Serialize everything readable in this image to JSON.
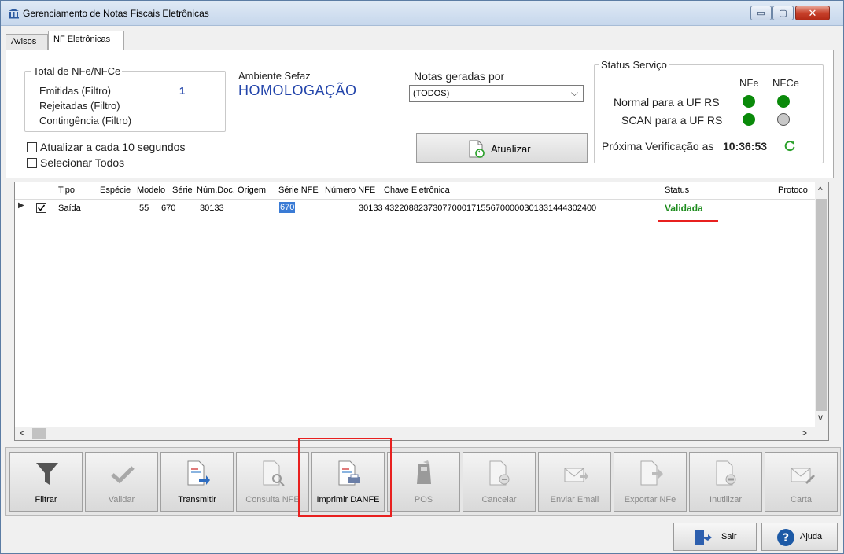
{
  "window": {
    "title": "Gerenciamento de Notas Fiscais Eletrônicas",
    "controls": {
      "minimize": "▭",
      "maximize": "▢",
      "close": "✕"
    }
  },
  "tabs": [
    {
      "label": "Avisos",
      "active": false
    },
    {
      "label": "NF Eletrônicas",
      "active": true
    }
  ],
  "totals": {
    "title": "Total de NFe/NFCe",
    "rows": [
      {
        "label": "Emitidas (Filtro)",
        "value": "1"
      },
      {
        "label": "Rejeitadas (Filtro)",
        "value": ""
      },
      {
        "label": "Contingência (Filtro)",
        "value": ""
      }
    ]
  },
  "ambiente": {
    "label": "Ambiente Sefaz",
    "value": "HOMOLOGAÇÃO"
  },
  "notas": {
    "label": "Notas geradas por",
    "selected": "(TODOS)"
  },
  "options": {
    "auto_refresh": {
      "label": "Atualizar a cada 10 segundos",
      "checked": false
    },
    "select_all": {
      "label": "Selecionar Todos",
      "checked": false
    }
  },
  "refresh_button": {
    "label": "Atualizar"
  },
  "status_servico": {
    "title": "Status Serviço",
    "col_nfe": "NFe",
    "col_nfce": "NFCe",
    "rows": [
      {
        "label": "Normal para a UF RS",
        "nfe": "green",
        "nfce": "green"
      },
      {
        "label": "SCAN para a UF RS",
        "nfe": "green",
        "nfce": "gray"
      }
    ],
    "next_check_label": "Próxima Verificação as",
    "next_check_time": "10:36:53"
  },
  "colors": {
    "ok": "#0a8a0a",
    "off": "#c8c8c8",
    "status_validada": "#1e8c1e",
    "ambiente": "#2244aa",
    "highlight": "#e8201f"
  },
  "grid": {
    "columns": [
      "Tipo",
      "Espécie",
      "Modelo",
      "Série",
      "Núm.Doc. Origem",
      "Série NFE",
      "Número NFE",
      "Chave Eletrônica",
      "Status",
      "Protoco"
    ],
    "rows": [
      {
        "checked": true,
        "tipo": "Saída",
        "especie": "",
        "modelo": "55",
        "serie": "670",
        "num_doc_origem": "30133",
        "serie_nfe": "670",
        "numero_nfe": "30133",
        "chave": "43220882373077000171556700000301331444302400",
        "status": "Validada",
        "protocolo": ""
      }
    ]
  },
  "toolbar": [
    {
      "label": "Filtrar",
      "icon": "funnel-icon",
      "enabled": true
    },
    {
      "label": "Validar",
      "icon": "check-icon",
      "enabled": false
    },
    {
      "label": "Transmitir",
      "icon": "document-send-icon",
      "enabled": true
    },
    {
      "label": "Consulta NFE",
      "icon": "document-search-icon",
      "enabled": false
    },
    {
      "label": "Imprimir DANFE",
      "icon": "document-print-icon",
      "enabled": true
    },
    {
      "label": "POS",
      "icon": "pos-terminal-icon",
      "enabled": false
    },
    {
      "label": "Cancelar",
      "icon": "document-cancel-icon",
      "enabled": false
    },
    {
      "label": "Enviar Email",
      "icon": "envelope-send-icon",
      "enabled": false
    },
    {
      "label": "Exportar NFe",
      "icon": "document-export-icon",
      "enabled": false
    },
    {
      "label": "Inutilizar",
      "icon": "document-void-icon",
      "enabled": false
    },
    {
      "label": "Carta",
      "icon": "envelope-pen-icon",
      "enabled": false
    }
  ],
  "bottom": {
    "sair": "Sair",
    "ajuda": "Ajuda"
  }
}
